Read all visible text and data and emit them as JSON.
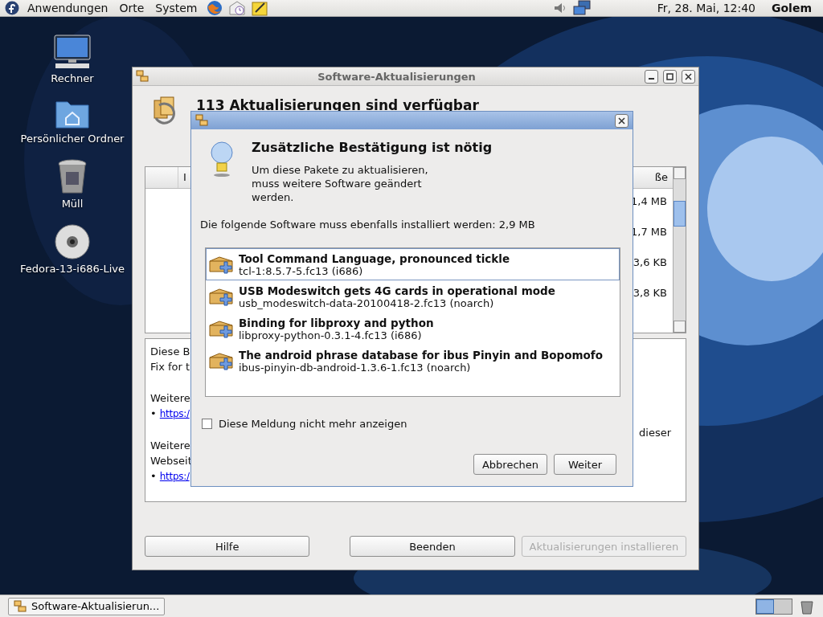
{
  "top_panel": {
    "menus": [
      "Anwendungen",
      "Orte",
      "System"
    ],
    "clock": "Fr, 28. Mai, 12:40",
    "user": "Golem"
  },
  "desktop_icons": [
    {
      "kind": "computer",
      "label": "Rechner"
    },
    {
      "kind": "home",
      "label": "Persönlicher Ordner"
    },
    {
      "kind": "trash",
      "label": "Müll"
    },
    {
      "kind": "dvd",
      "label": "Fedora-13-i686-Live"
    }
  ],
  "main_window": {
    "title": "Software-Aktualisierungen",
    "heading": "113 Aktualisierungen sind verfügbar",
    "columns": [
      "I",
      "ße"
    ],
    "sizes": [
      "1,4 MB",
      "1,7 MB",
      "3,6 KB",
      "3,8 KB"
    ],
    "details_left": [
      [
        {
          "kind": "text",
          "text": "Diese B"
        },
        {
          "kind": "text",
          "text": "Fix for t"
        }
      ],
      [
        {
          "kind": "text",
          "text": "Weitere"
        },
        {
          "kind": "link",
          "bullet": "•",
          "text": "https:/"
        }
      ],
      [
        {
          "kind": "text",
          "text": "Weitere"
        },
        {
          "kind": "text",
          "text": "Webseit"
        },
        {
          "kind": "link",
          "bullet": "•",
          "text": "https:/"
        }
      ]
    ],
    "details_right": "dieser",
    "buttons": [
      {
        "label": "Hilfe",
        "disabled": false
      },
      {
        "label": "Beenden",
        "disabled": false
      },
      {
        "label": "Aktualisierungen installieren",
        "disabled": true
      }
    ]
  },
  "dialog": {
    "heading": "Zusätzliche Bestätigung ist nötig",
    "message": "Um diese Pakete zu aktualisieren, muss weitere Software geändert werden.",
    "summary": "Die folgende Software muss ebenfalls installiert werden: 2,9 MB",
    "packages": [
      {
        "name": "Tool Command Language, pronounced tickle",
        "id": "tcl-1:8.5.7-5.fc13 (i686)",
        "selected": true
      },
      {
        "name": "USB Modeswitch gets 4G cards in operational mode",
        "id": "usb_modeswitch-data-20100418-2.fc13 (noarch)",
        "selected": false
      },
      {
        "name": "Binding for libproxy and python",
        "id": "libproxy-python-0.3.1-4.fc13 (i686)",
        "selected": false
      },
      {
        "name": "The android phrase database for ibus Pinyin and Bopomofo",
        "id": "ibus-pinyin-db-android-1.3.6-1.fc13 (noarch)",
        "selected": false
      }
    ],
    "checkbox": {
      "label": "Diese Meldung nicht mehr anzeigen",
      "checked": false
    },
    "buttons": [
      "Abbrechen",
      "Weiter"
    ]
  },
  "taskbar": {
    "task": "Software-Aktualisierun..."
  }
}
